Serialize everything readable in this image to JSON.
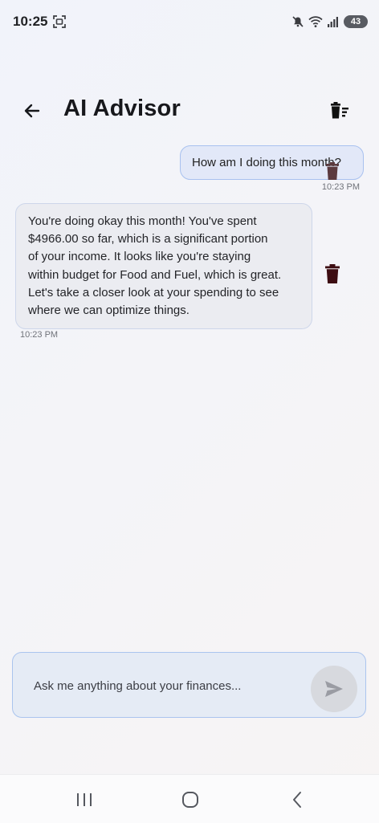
{
  "status_bar": {
    "time": "10:25",
    "battery_level": "43",
    "icons": [
      "screen-record-icon",
      "mute-icon",
      "wifi-icon",
      "cell-signal-icon",
      "battery-icon"
    ]
  },
  "header": {
    "title": "AI Advisor",
    "back_icon": "arrow-left-icon",
    "clear_icon": "delete-sweep-icon"
  },
  "messages": [
    {
      "role": "user",
      "text": "How am I doing this month?",
      "time": "10:23 PM"
    },
    {
      "role": "assistant",
      "lines": [
        "You're doing okay this month! You've spent",
        "$4966.00 so far, which is a significant portion",
        "of your income. It looks like you're staying",
        "within budget for Food and Fuel, which is great.",
        "Let's take a closer look at your spending to see",
        "where we can optimize things."
      ],
      "time": "10:23 PM"
    }
  ],
  "composer": {
    "placeholder": "Ask me anything about your finances...",
    "value": "",
    "send_icon": "send-icon"
  },
  "nav_bar": {
    "icons": [
      "recents-icon",
      "home-icon",
      "back-icon"
    ]
  },
  "colors": {
    "user_bubble": "#e2e8f8",
    "ai_bubble": "#ebecf1",
    "delete_icon_dark": "#3d0d12",
    "accent_border": "#a8c1ef"
  }
}
